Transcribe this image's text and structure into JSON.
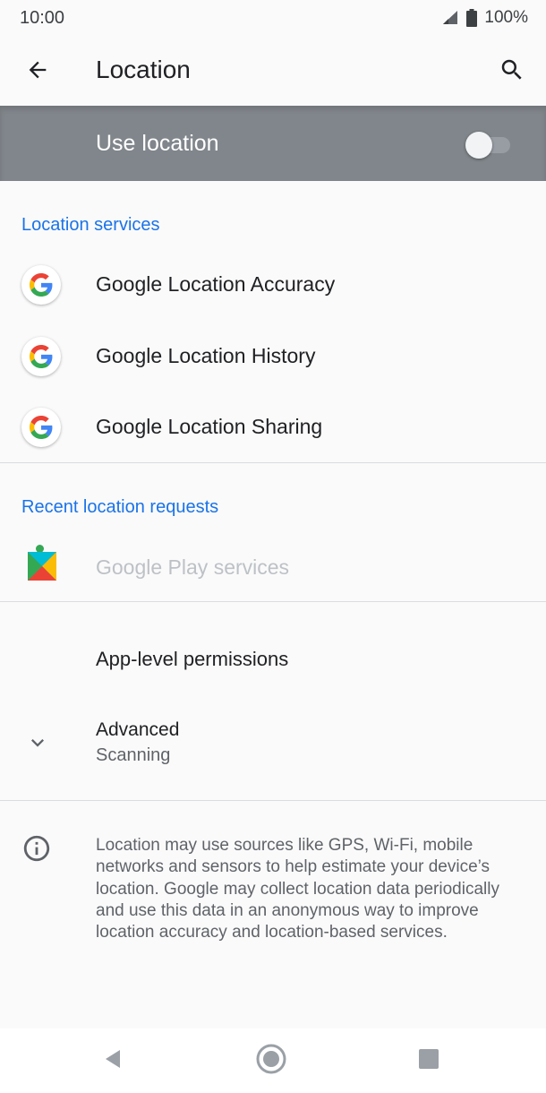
{
  "status_bar": {
    "time": "10:00",
    "battery": "100%"
  },
  "app_bar": {
    "title": "Location",
    "back_icon": "arrow-back-icon",
    "search_icon": "search-icon"
  },
  "master_switch": {
    "label": "Use location",
    "checked": false
  },
  "location_services": {
    "header": "Location services",
    "items": [
      {
        "label": "Google Location Accuracy",
        "icon": "google-g-icon"
      },
      {
        "label": "Google Location History",
        "icon": "google-g-icon"
      },
      {
        "label": "Google Location Sharing",
        "icon": "google-g-icon"
      }
    ]
  },
  "recent_requests": {
    "header": "Recent location requests",
    "items": [
      {
        "label": "Google Play services",
        "icon": "google-play-services-icon",
        "disabled": true
      }
    ]
  },
  "app_level": {
    "label": "App-level permissions"
  },
  "advanced": {
    "title": "Advanced",
    "subtitle": "Scanning",
    "icon": "chevron-down-icon"
  },
  "footer_info": {
    "icon": "info-icon",
    "text": "Location may use sources like GPS, Wi-Fi, mobile networks and sensors to help estimate your device’s location. Google may collect location data periodically and use this data in an anonymous way to improve location accuracy and location-based services."
  },
  "nav_bar": {
    "back": "nav-back-icon",
    "home": "nav-home-icon",
    "recents": "nav-recents-icon"
  },
  "colors": {
    "accent": "#1a73e8",
    "master_bg": "#80868b",
    "background": "#fafafa"
  }
}
